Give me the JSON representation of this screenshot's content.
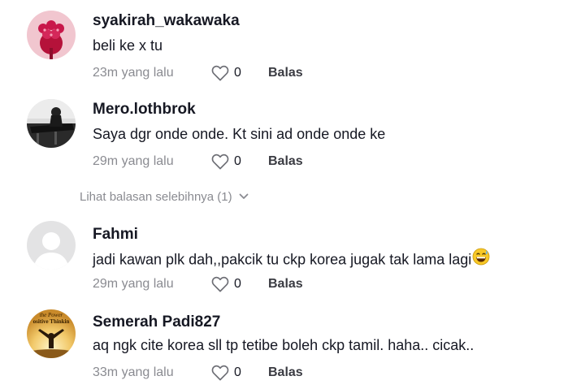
{
  "comments": [
    {
      "username": "syakirah_wakawaka",
      "text": "beli ke x tu",
      "time": "23m yang lalu",
      "likes": "0",
      "reply_label": "Balas",
      "avatar_icon": "pink-flower-avatar",
      "avatar_bg": "#f1c6cf"
    },
    {
      "username": "Mero.lothbrok",
      "text": "Saya dgr onde onde. Kt sini ad onde onde ke",
      "time": "29m yang lalu",
      "likes": "0",
      "reply_label": "Balas",
      "avatar_icon": "bw-photo-avatar"
    },
    {
      "username": "Fahmi",
      "text": "jadi kawan plk dah,,pakcik tu ckp korea jugak tak lama lagi",
      "emoji": "grinning-sweat-emoji",
      "time": "29m yang lalu",
      "likes": "0",
      "reply_label": "Balas",
      "avatar_icon": "default-user-avatar"
    },
    {
      "username": "Semerah Padi827",
      "text": "aq ngk cite korea sll tp tetibe boleh ckp tamil. haha.. cicak..",
      "time": "33m yang lalu",
      "likes": "0",
      "reply_label": "Balas",
      "avatar_icon": "book-cover-avatar",
      "avatar_text": [
        "the Power",
        "ositive Thinkin"
      ]
    }
  ],
  "more_replies": {
    "label": "Lihat balasan selebihnya (1)",
    "icon": "chevron-down-icon"
  },
  "colors": {
    "primary_text": "#161823",
    "secondary_text": "#8a8b91",
    "background": "#ffffff"
  }
}
